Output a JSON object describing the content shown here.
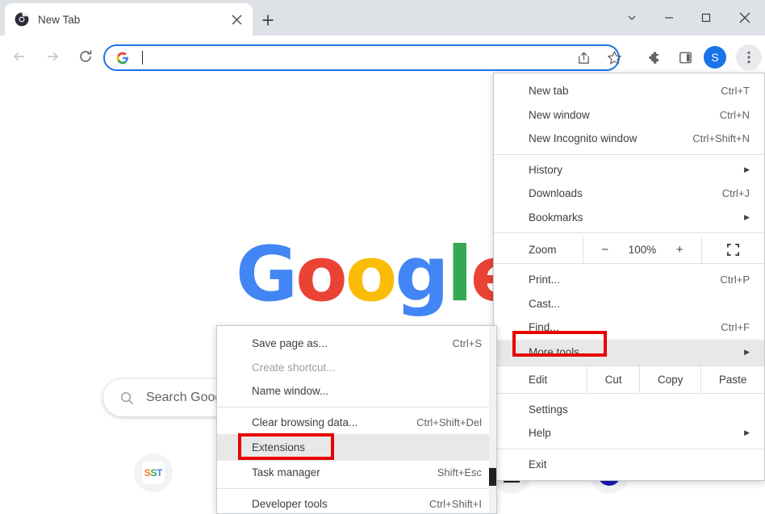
{
  "window": {
    "controls": [
      {
        "name": "chevron-down",
        "glyph": "⌄"
      },
      {
        "name": "minimize",
        "glyph": "—"
      },
      {
        "name": "maximize",
        "glyph": "□"
      },
      {
        "name": "close",
        "glyph": "✕"
      }
    ]
  },
  "tabstrip": {
    "tab_title": "New Tab",
    "close_glyph": "✕",
    "newtab_glyph": "+"
  },
  "toolbar": {
    "back_glyph": "←",
    "forward_glyph": "→",
    "reload_glyph": "⟳",
    "omnibox_value": "",
    "omnibox_placeholder": "",
    "avatar_letter": "S"
  },
  "page": {
    "logo": [
      {
        "ch": "G",
        "color": "#4285f4"
      },
      {
        "ch": "o",
        "color": "#ea4335"
      },
      {
        "ch": "o",
        "color": "#fbbc05"
      },
      {
        "ch": "g",
        "color": "#4285f4"
      },
      {
        "ch": "l",
        "color": "#34a853"
      },
      {
        "ch": "e",
        "color": "#ea4335"
      }
    ],
    "search_placeholder": "Search Google or type a URL",
    "tiles": [
      {
        "label": "SST",
        "letters": [
          {
            "ch": "S",
            "color": "#ea7d28"
          },
          {
            "ch": "S",
            "color": "#34a853"
          },
          {
            "ch": "T",
            "color": "#4285f4"
          }
        ]
      },
      {
        "label": ""
      },
      {
        "label": "➤"
      }
    ]
  },
  "main_menu": {
    "items": [
      {
        "label": "New tab",
        "accel": "Ctrl+T",
        "arrow": false
      },
      {
        "label": "New window",
        "accel": "Ctrl+N",
        "arrow": false
      },
      {
        "label": "New Incognito window",
        "accel": "Ctrl+Shift+N",
        "arrow": false
      },
      {
        "sep": true
      },
      {
        "label": "History",
        "accel": "",
        "arrow": true
      },
      {
        "label": "Downloads",
        "accel": "Ctrl+J",
        "arrow": false
      },
      {
        "label": "Bookmarks",
        "accel": "",
        "arrow": true
      },
      {
        "sep": true
      },
      {
        "zoom": true
      },
      {
        "sep": true
      },
      {
        "label": "Print...",
        "accel": "Ctrl+P",
        "arrow": false
      },
      {
        "label": "Cast...",
        "accel": "",
        "arrow": false
      },
      {
        "label": "Find...",
        "accel": "Ctrl+F",
        "arrow": false
      },
      {
        "label": "More tools",
        "accel": "",
        "arrow": true,
        "highlighted": true,
        "redbox": true
      },
      {
        "sep": true
      },
      {
        "edit": true
      },
      {
        "sep": true
      },
      {
        "label": "Settings",
        "accel": "",
        "arrow": false
      },
      {
        "label": "Help",
        "accel": "",
        "arrow": true
      },
      {
        "sep": true
      },
      {
        "label": "Exit",
        "accel": "",
        "arrow": false
      }
    ],
    "zoom_row": {
      "label": "Zoom",
      "minus": "−",
      "percent": "100%",
      "plus": "+"
    },
    "edit_row": {
      "label": "Edit",
      "cut": "Cut",
      "copy": "Copy",
      "paste": "Paste"
    }
  },
  "sub_menu": {
    "items": [
      {
        "label": "Save page as...",
        "accel": "Ctrl+S",
        "dim": false
      },
      {
        "label": "Create shortcut...",
        "accel": "",
        "dim": true
      },
      {
        "label": "Name window...",
        "accel": "",
        "dim": false
      },
      {
        "sep": true
      },
      {
        "label": "Clear browsing data...",
        "accel": "Ctrl+Shift+Del",
        "dim": false
      },
      {
        "label": "Extensions",
        "accel": "",
        "dim": false,
        "highlighted": true,
        "redbox": true
      },
      {
        "label": "Task manager",
        "accel": "Shift+Esc",
        "dim": false
      },
      {
        "sep": true
      },
      {
        "label": "Developer tools",
        "accel": "Ctrl+Shift+I",
        "dim": false
      }
    ]
  },
  "highlight_color": "#e80000"
}
